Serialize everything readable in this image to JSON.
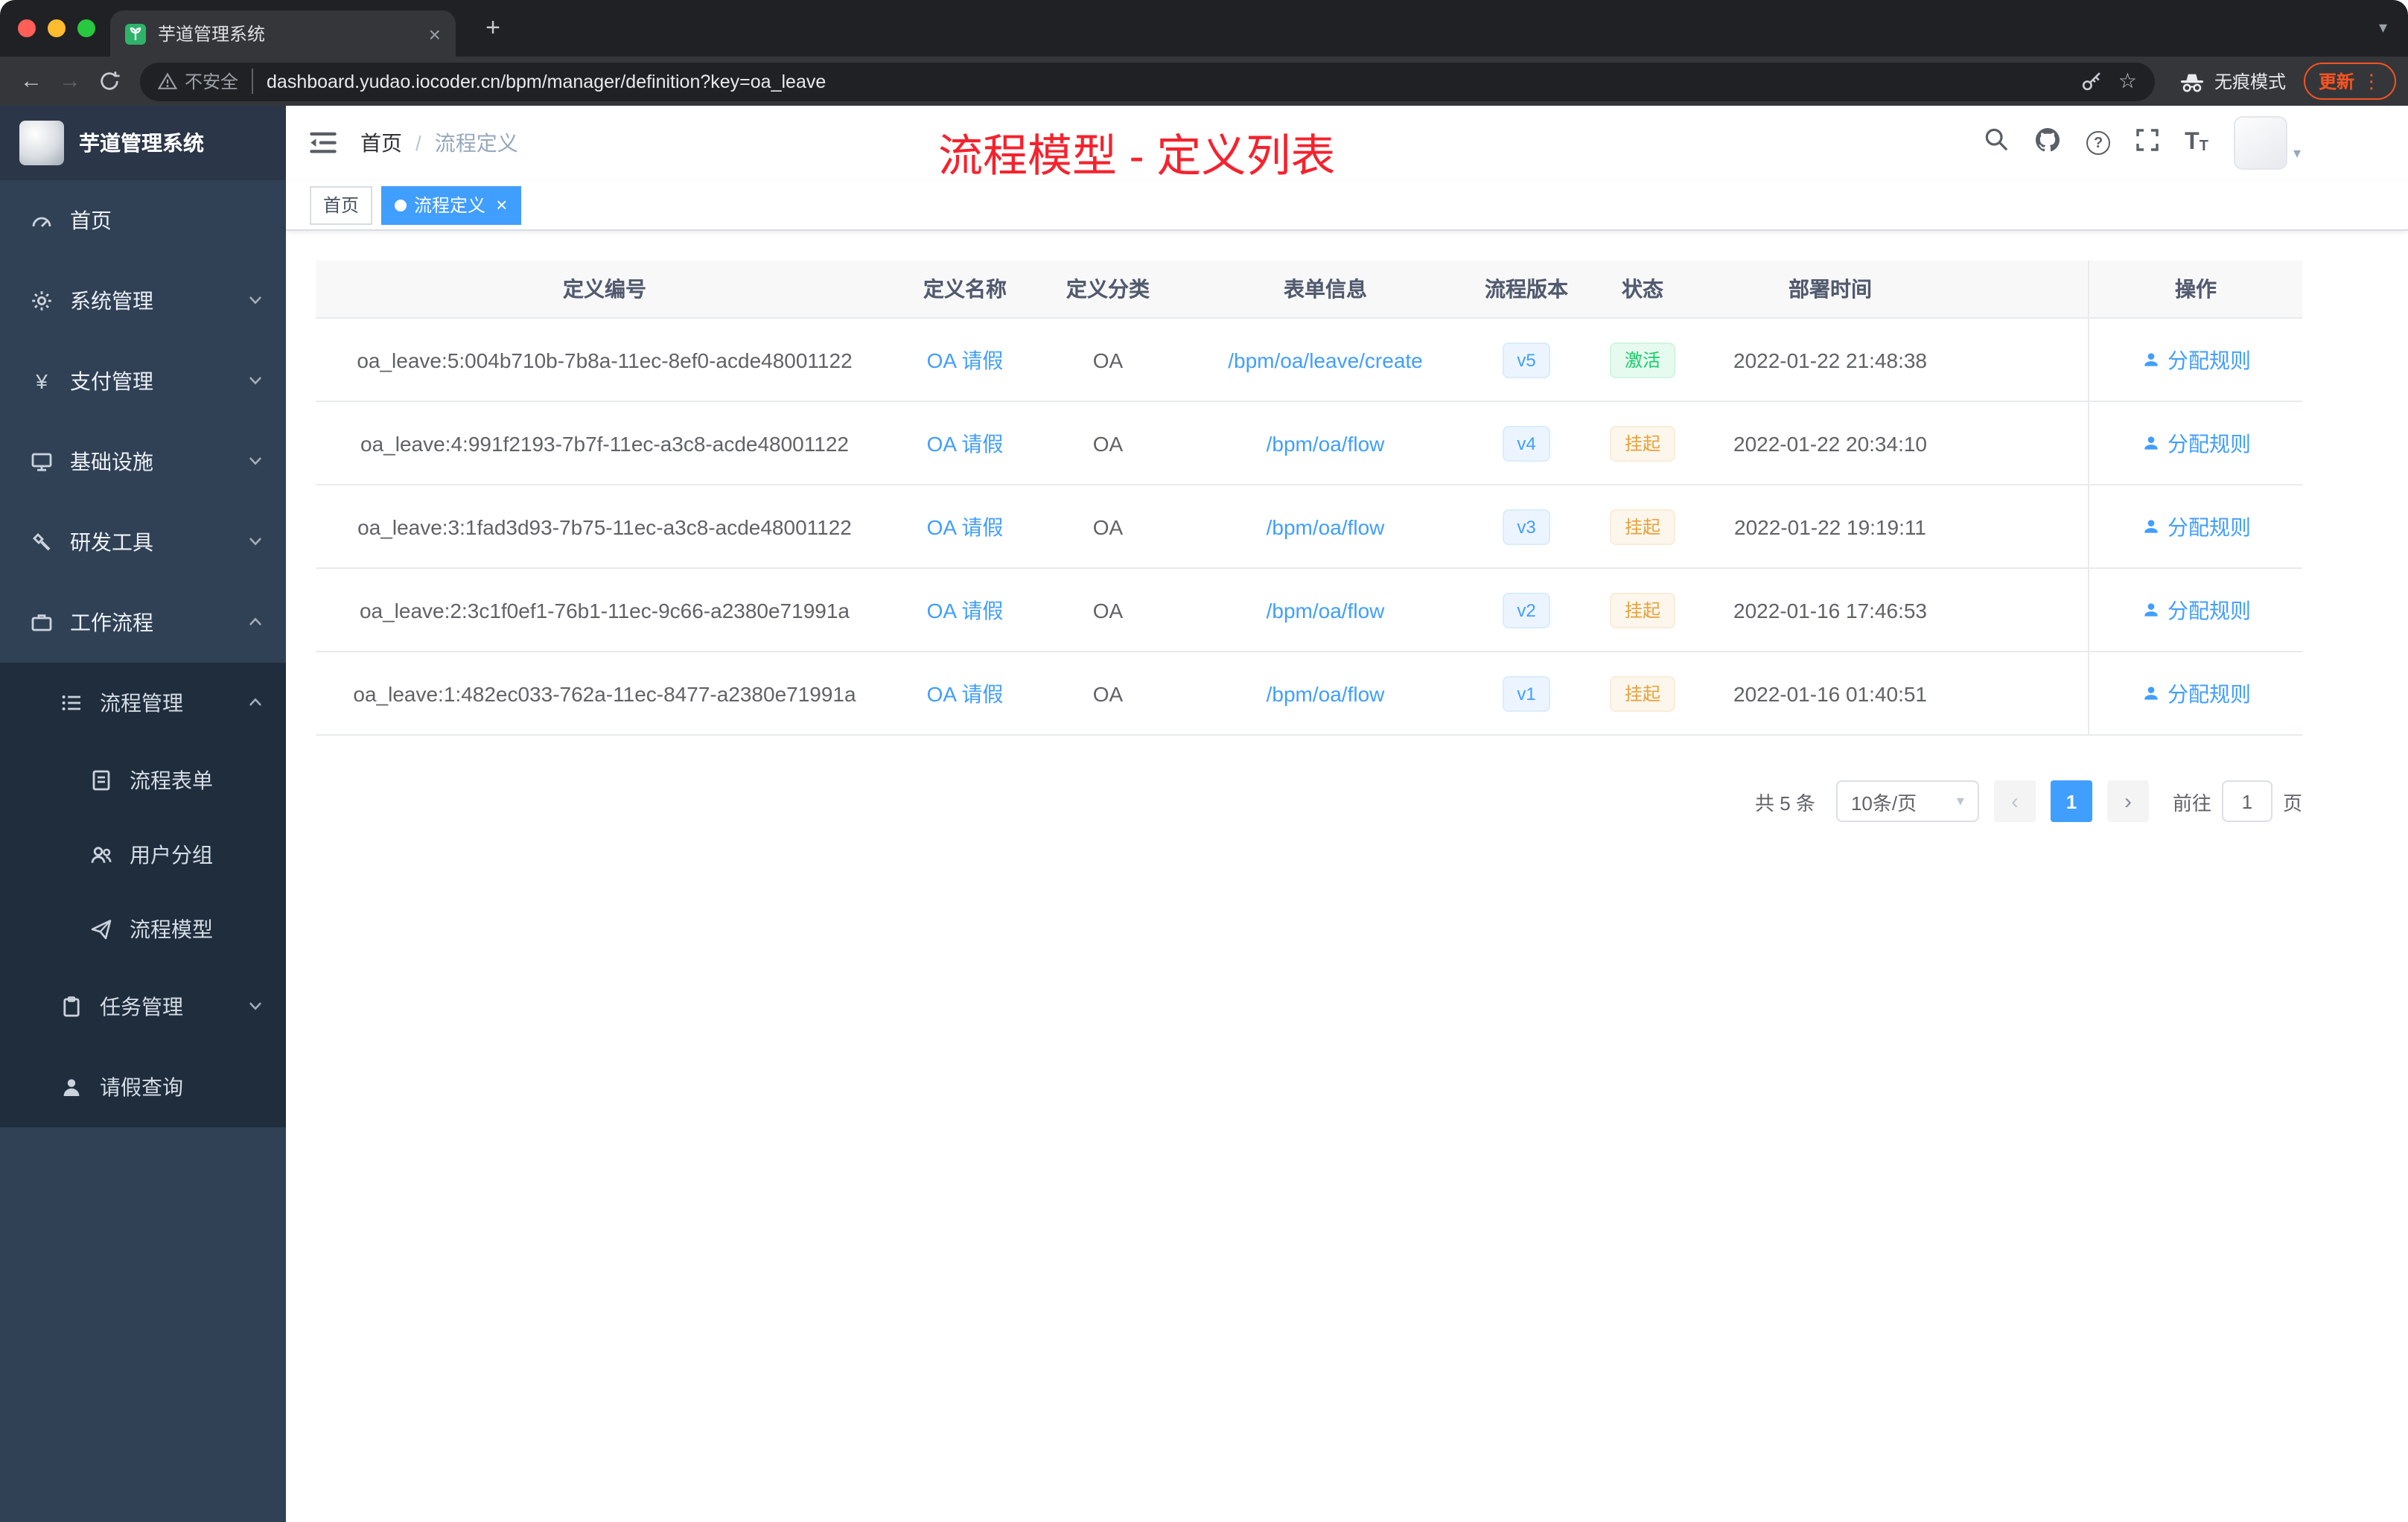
{
  "browser": {
    "tab_title": "芋道管理系统",
    "security_label": "不安全",
    "url": "dashboard.yudao.iocoder.cn/bpm/manager/definition?key=oa_leave",
    "incognito_label": "无痕模式",
    "update_label": "更新"
  },
  "icons": {
    "back": "←",
    "forward": "→",
    "star": "☆",
    "more_vertical": "⋮",
    "close": "×",
    "new_tab": "+",
    "caret_down": "▾",
    "prev": "‹",
    "next": "›",
    "help": "?",
    "yen": "¥",
    "size_letter": "T"
  },
  "sidebar": {
    "logo_title": "芋道管理系统",
    "items": [
      {
        "label": "首页"
      },
      {
        "label": "系统管理"
      },
      {
        "label": "支付管理"
      },
      {
        "label": "基础设施"
      },
      {
        "label": "研发工具"
      },
      {
        "label": "工作流程"
      },
      {
        "label": "流程管理"
      },
      {
        "label": "流程表单"
      },
      {
        "label": "用户分组"
      },
      {
        "label": "流程模型"
      },
      {
        "label": "任务管理"
      },
      {
        "label": "请假查询"
      }
    ]
  },
  "header": {
    "breadcrumb": {
      "home": "首页",
      "separator": "/",
      "current": "流程定义"
    },
    "annotation": "流程模型 - 定义列表"
  },
  "tags": [
    {
      "label": "首页",
      "active": false
    },
    {
      "label": "流程定义",
      "active": true
    }
  ],
  "table": {
    "columns": [
      "定义编号",
      "定义名称",
      "定义分类",
      "表单信息",
      "流程版本",
      "状态",
      "部署时间",
      "操作"
    ],
    "rows": [
      {
        "id": "oa_leave:5:004b710b-7b8a-11ec-8ef0-acde48001122",
        "name": "OA 请假",
        "category": "OA",
        "form": "/bpm/oa/leave/create",
        "version": "v5",
        "status": "激活",
        "status_type": "success",
        "time": "2022-01-22 21:48:38",
        "action": "分配规则"
      },
      {
        "id": "oa_leave:4:991f2193-7b7f-11ec-a3c8-acde48001122",
        "name": "OA 请假",
        "category": "OA",
        "form": "/bpm/oa/flow",
        "version": "v4",
        "status": "挂起",
        "status_type": "warning",
        "time": "2022-01-22 20:34:10",
        "action": "分配规则"
      },
      {
        "id": "oa_leave:3:1fad3d93-7b75-11ec-a3c8-acde48001122",
        "name": "OA 请假",
        "category": "OA",
        "form": "/bpm/oa/flow",
        "version": "v3",
        "status": "挂起",
        "status_type": "warning",
        "time": "2022-01-22 19:19:11",
        "action": "分配规则"
      },
      {
        "id": "oa_leave:2:3c1f0ef1-76b1-11ec-9c66-a2380e71991a",
        "name": "OA 请假",
        "category": "OA",
        "form": "/bpm/oa/flow",
        "version": "v2",
        "status": "挂起",
        "status_type": "warning",
        "time": "2022-01-16 17:46:53",
        "action": "分配规则"
      },
      {
        "id": "oa_leave:1:482ec033-762a-11ec-8477-a2380e71991a",
        "name": "OA 请假",
        "category": "OA",
        "form": "/bpm/oa/flow",
        "version": "v1",
        "status": "挂起",
        "status_type": "warning",
        "time": "2022-01-16 01:40:51",
        "action": "分配规则"
      }
    ]
  },
  "pagination": {
    "total": "共 5 条",
    "page_size": "10条/页",
    "current_page": "1",
    "goto_label": "前往",
    "goto_value": "1",
    "goto_unit": "页"
  },
  "colors": {
    "primary": "#409eff",
    "success": "#13ce66",
    "warning": "#e6a23c",
    "annotation": "#f5222d",
    "sidebar": "#304156",
    "submenu": "#1f2d3d"
  }
}
